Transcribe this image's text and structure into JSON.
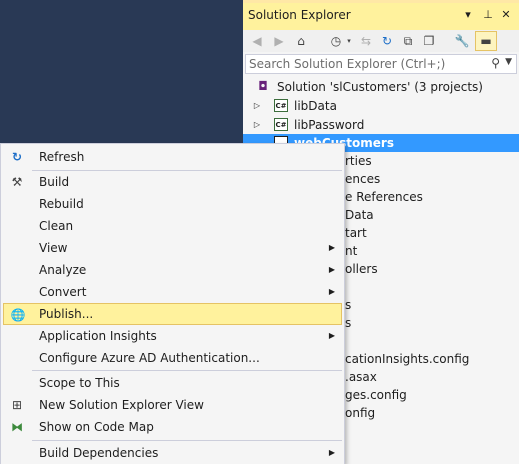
{
  "solution_explorer": {
    "title": "Solution Explorer",
    "title_buttons": {
      "dropdown": "▾",
      "pin": "⊥",
      "close": "✕"
    },
    "search_placeholder": "Search Solution Explorer (Ctrl+;)",
    "tree": {
      "solution": "Solution 'slCustomers' (3 projects)",
      "projects": [
        {
          "label": "libData",
          "icon": "csharp-project-icon"
        },
        {
          "label": "libPassword",
          "icon": "csharp-project-icon"
        },
        {
          "label": "webCustomers",
          "icon": "web-project-icon",
          "selected": true
        }
      ],
      "partial_items": [
        "rties",
        "ences",
        "e References",
        "Data",
        "tart",
        "nt",
        "ollers",
        "s",
        "s",
        "cationInsights.config",
        ".asax",
        "ges.config",
        "onfig"
      ]
    }
  },
  "context_menu": {
    "items": [
      {
        "label": "Refresh",
        "icon": "refresh-icon"
      },
      {
        "label": "Build",
        "icon": "build-icon"
      },
      {
        "label": "Rebuild"
      },
      {
        "label": "Clean"
      },
      {
        "label": "View",
        "submenu": true
      },
      {
        "label": "Analyze",
        "submenu": true
      },
      {
        "label": "Convert",
        "submenu": true
      },
      {
        "label": "Publish...",
        "icon": "publish-globe-icon",
        "highlighted": true
      },
      {
        "label": "Application Insights",
        "submenu": true
      },
      {
        "label": "Configure Azure AD Authentication..."
      },
      {
        "label": "Scope to This"
      },
      {
        "label": "New Solution Explorer View",
        "icon": "new-view-icon"
      },
      {
        "label": "Show on Code Map",
        "icon": "code-map-icon"
      },
      {
        "label": "Build Dependencies",
        "submenu": true
      }
    ]
  },
  "colors": {
    "background": "#293955",
    "title_bar": "#fff29d",
    "selection": "#3399ff",
    "menu_highlight": "#fff29d"
  }
}
